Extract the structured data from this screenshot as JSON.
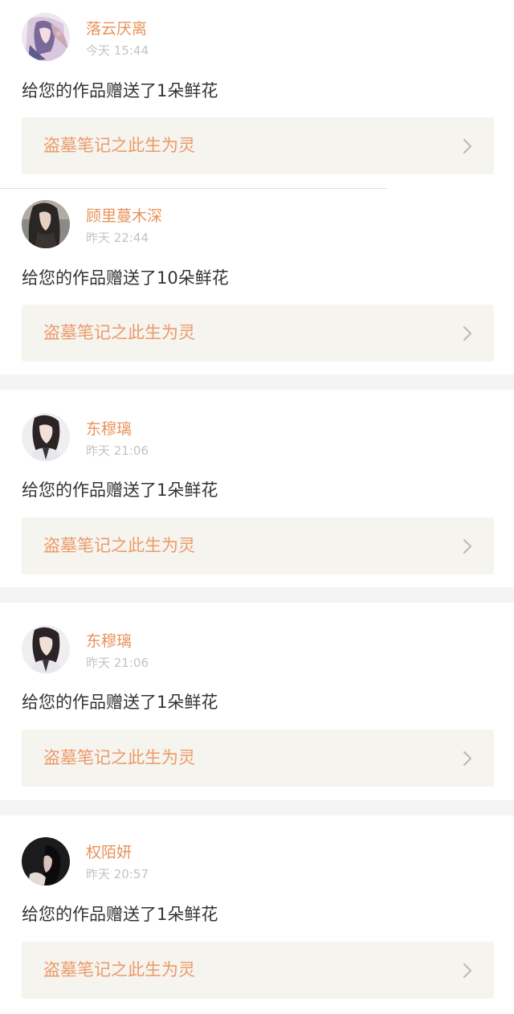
{
  "theme": {
    "username_color": "#e8925a",
    "work_title_color": "#ec9a6a",
    "card_bg": "#f5f4ee",
    "timestamp_color": "#c3c3c3",
    "message_color": "#333333",
    "separator_color": "#f4f4f4"
  },
  "notifications": [
    {
      "username": "落云厌离",
      "time": "今天 15:44",
      "message": "给您的作品赠送了1朵鲜花",
      "work_title": "盗墓笔记之此生为灵",
      "avatar_icon": "avatar-anime-girl-icon"
    },
    {
      "username": "顾里蔓木深",
      "time": "昨天 22:44",
      "message": "给您的作品赠送了10朵鲜花",
      "work_title": "盗墓笔记之此生为灵",
      "avatar_icon": "avatar-dark-hair-girl-icon"
    },
    {
      "username": "东穆璃",
      "time": "昨天 21:06",
      "message": "给您的作品赠送了1朵鲜花",
      "work_title": "盗墓笔记之此生为灵",
      "avatar_icon": "avatar-girl-portrait-icon"
    },
    {
      "username": "东穆璃",
      "time": "昨天 21:06",
      "message": "给您的作品赠送了1朵鲜花",
      "work_title": "盗墓笔记之此生为灵",
      "avatar_icon": "avatar-girl-portrait-icon"
    },
    {
      "username": "权陌妍",
      "time": "昨天 20:57",
      "message": "给您的作品赠送了1朵鲜花",
      "work_title": "盗墓笔记之此生为灵",
      "avatar_icon": "avatar-dark-photo-icon"
    }
  ]
}
